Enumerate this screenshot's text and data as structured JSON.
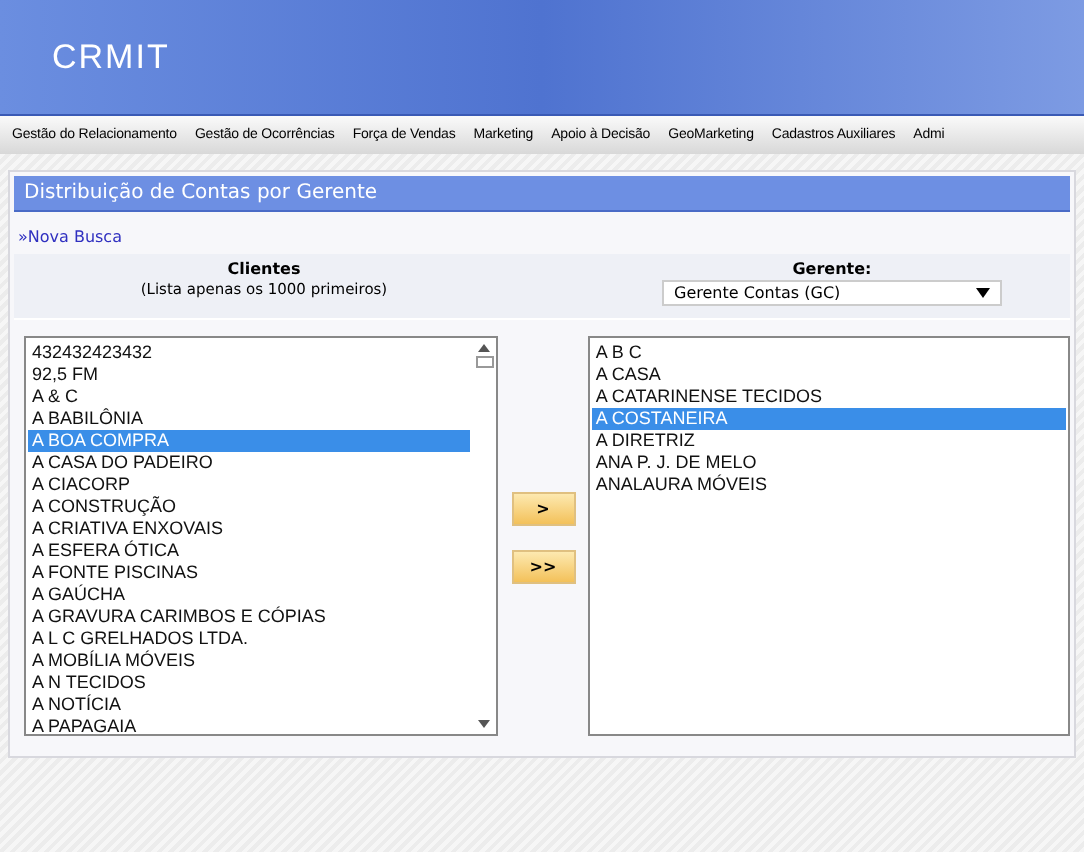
{
  "header": {
    "logo": "CRMIT"
  },
  "menu": [
    "Gestão do Relacionamento",
    "Gestão de Ocorrências",
    "Força de Vendas",
    "Marketing",
    "Apoio à Decisão",
    "GeoMarketing",
    "Cadastros Auxiliares",
    "Admi"
  ],
  "panel": {
    "title": "Distribuição de Contas por Gerente",
    "link": "»Nova Busca",
    "clients": {
      "heading": "Clientes",
      "note": "(Lista apenas os 1000 primeiros)",
      "items": [
        {
          "label": "432432423432",
          "selected": false
        },
        {
          "label": "92,5 FM",
          "selected": false
        },
        {
          "label": "A & C",
          "selected": false
        },
        {
          "label": "A BABILÔNIA",
          "selected": false
        },
        {
          "label": "A BOA COMPRA",
          "selected": true
        },
        {
          "label": "A CASA DO PADEIRO",
          "selected": false
        },
        {
          "label": "A CIACORP",
          "selected": false
        },
        {
          "label": "A CONSTRUÇÃO",
          "selected": false
        },
        {
          "label": "A CRIATIVA ENXOVAIS",
          "selected": false
        },
        {
          "label": "A ESFERA ÓTICA",
          "selected": false
        },
        {
          "label": "A FONTE PISCINAS",
          "selected": false
        },
        {
          "label": "A GAÚCHA",
          "selected": false
        },
        {
          "label": "A GRAVURA CARIMBOS E CÓPIAS",
          "selected": false
        },
        {
          "label": "A L C GRELHADOS LTDA.",
          "selected": false
        },
        {
          "label": "A MOBÍLIA MÓVEIS",
          "selected": false
        },
        {
          "label": "A N TECIDOS",
          "selected": false
        },
        {
          "label": "A NOTÍCIA",
          "selected": false
        },
        {
          "label": "A PAPAGAIA",
          "selected": false
        }
      ]
    },
    "buttons": [
      ">",
      ">>"
    ],
    "manager": {
      "heading": "Gerente:",
      "value": "Gerente Contas (GC)",
      "items": [
        {
          "label": "A B C",
          "selected": false
        },
        {
          "label": "A CASA",
          "selected": false
        },
        {
          "label": "A CATARINENSE TECIDOS",
          "selected": false
        },
        {
          "label": "A COSTANEIRA",
          "selected": true
        },
        {
          "label": "A DIRETRIZ",
          "selected": false
        },
        {
          "label": "ANA P. J. DE MELO",
          "selected": false
        },
        {
          "label": "ANALAURA MÓVEIS",
          "selected": false
        }
      ]
    }
  }
}
